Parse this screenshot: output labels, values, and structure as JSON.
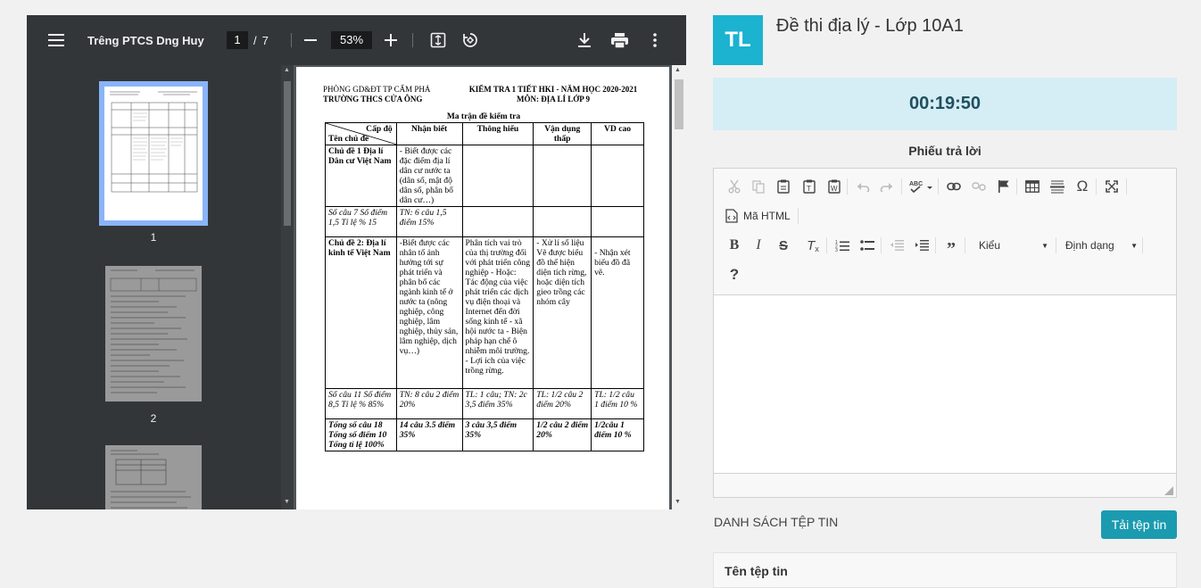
{
  "pdf": {
    "title": "Trêng PTCS Dng Huy",
    "page_current": "1",
    "page_sep": "/",
    "page_total": "7",
    "zoom": "53%",
    "thumbs": [
      {
        "label": "1"
      },
      {
        "label": "2"
      }
    ],
    "doc": {
      "left_head_1": "PHÒNG GD&ĐT TP CẨM PHẢ",
      "left_head_2": "TRƯỜNG THCS CỬA ÔNG",
      "right_head_1": "KIỂM TRA 1 TIẾT HKI - NĂM HỌC 2020-2021",
      "right_head_2": "MÔN: ĐỊA LÍ LỚP 9",
      "table_title": "Ma trận đề kiểm tra",
      "hdr_capdo": "Cấp độ",
      "hdr_chude": "Tên chủ đề",
      "hdr_nb": "Nhận biết",
      "hdr_th": "Thông hiểu",
      "hdr_vdt": "Vận dụng thấp",
      "hdr_vdc": "VD cao",
      "r1_topic": "Chủ đề 1 Địa lí Dân cư Việt Nam",
      "r1_nb": "- Biết được các đặc điểm địa lí dân cư nước ta (dân số, mật độ dân số, phân bố dân cư…)",
      "r2_score": "Số câu 7 Số điểm 1,5 Tỉ lệ % 15",
      "r2_nb": "TN: 6 câu 1,5 điểm 15%",
      "r3_topic": "Chủ đề 2: Địa lí kinh tế Việt Nam",
      "r3_nb": "-Biết được các nhân tố ảnh hưởng tới sự phát triển và phân bố các ngành kinh tế ở nước ta (nông nghiệp, công nghiệp, lâm nghiệp, thủy sản, lâm nghiệp, dịch vụ…)",
      "r3_th": "Phân tích vai trò của thị trường đối với phát triển công nghiệp - Hoặc: Tác động của việc phát triển các dịch vụ điện thoại và Internet đến đời sống kinh tế - xã hội nước ta - Biện pháp hạn chế ô nhiễm môi trường. - Lợi ích của việc trồng rừng.",
      "r3_vdt": "- Xử lí số liệu Vẽ được biểu đồ thể hiện diện tích rừng, hoặc diện tích gieo trồng các nhóm cây",
      "r3_vdc": "- Nhận xét biểu đồ đã vẽ.",
      "r4_score": "Số câu 11 Số điểm 8,5 Tỉ lệ % 85%",
      "r4_nb": "TN: 8 câu 2 điểm 20%",
      "r4_th": "TL: 1 câu; TN: 2c 3,5 điểm 35%",
      "r4_vdt": "TL: 1/2 câu 2 điểm 20%",
      "r4_vdc": "TL: 1/2 câu 1 điểm 10 %",
      "r5_total": "Tổng số câu 18 Tổng số điểm 10 Tổng tỉ lệ 100%",
      "r5_nb": "14 câu 3.5 điểm 35%",
      "r5_th": "3 câu 3,5 điểm 35%",
      "r5_vdt": "1/2 câu 2 điểm 20%",
      "r5_vdc": "1/2câu 1 điểm 10 %"
    }
  },
  "exam": {
    "avatar_initials": "TL",
    "title": "Đề thi địa lý - Lớp 10A1",
    "timer": "00:19:50",
    "answer_heading": "Phiếu trả lời"
  },
  "editor": {
    "source_label": "Mã HTML",
    "styles_label": "Kiểu",
    "format_label": "Định dạng",
    "help_label": "?"
  },
  "files": {
    "heading": "DANH SÁCH TỆP TIN",
    "upload_label": "Tải tệp tin",
    "col_name": "Tên tệp tin"
  },
  "colors": {
    "accent": "#1bb3d0",
    "button": "#1b9bb0",
    "timer_bg": "#d5edf4",
    "timer_text": "#1f5060"
  }
}
